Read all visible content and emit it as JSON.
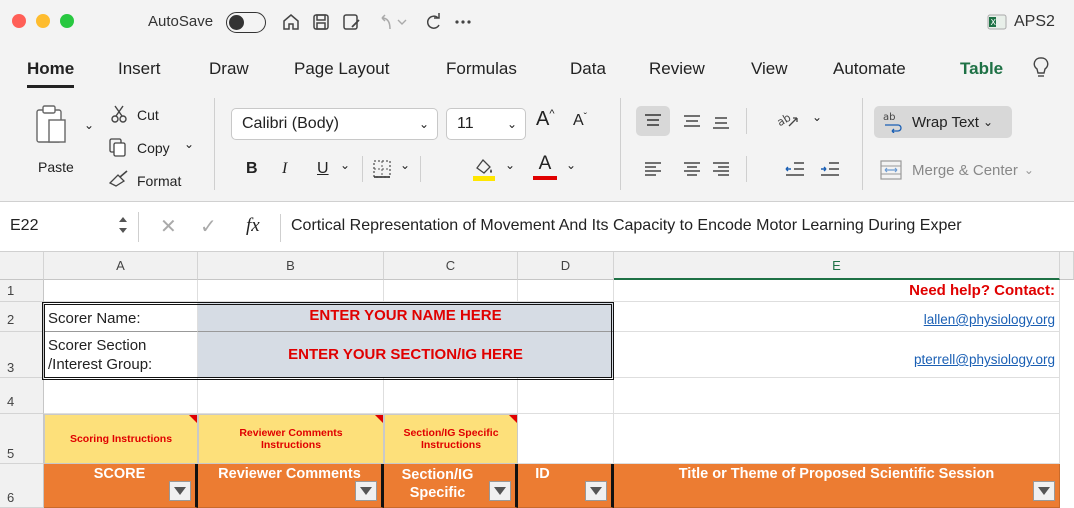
{
  "titlebar": {
    "autosave_label": "AutoSave",
    "workbook_name": "APS2",
    "colors": {
      "close": "#ff5f57",
      "minimize": "#febc2e",
      "zoom": "#28c840"
    },
    "quick_access_icons": [
      "home-icon",
      "save-icon",
      "save-as-icon",
      "undo-icon",
      "undo-dropdown-icon",
      "redo-icon",
      "more-icon"
    ]
  },
  "ribbon_tabs": [
    "Home",
    "Insert",
    "Draw",
    "Page Layout",
    "Formulas",
    "Data",
    "Review",
    "View",
    "Automate",
    "Table"
  ],
  "clipboard": {
    "paste": "Paste",
    "cut": "Cut",
    "copy": "Copy",
    "format": "Format"
  },
  "font": {
    "name": "Calibri (Body)",
    "size": "11",
    "bold": "B",
    "italic": "I",
    "underline": "U",
    "font_color_letter": "A",
    "grow": "A",
    "shrink": "A"
  },
  "alignment": {
    "wrap_text": "Wrap Text",
    "merge_center": "Merge & Center"
  },
  "formula_bar": {
    "name_box": "E22",
    "fx": "fx",
    "content": "Cortical Representation of Movement And Its Capacity to Encode Motor Learning During Exper"
  },
  "sheet": {
    "columns": [
      "A",
      "B",
      "C",
      "D",
      "E"
    ],
    "rows": [
      "1",
      "2",
      "3",
      "4",
      "5",
      "6"
    ],
    "need_help": "Need help?  Contact:",
    "scorer_name_label": "Scorer Name:",
    "scorer_name_value": "ENTER YOUR NAME HERE",
    "scorer_section_label_1": "Scorer Section",
    "scorer_section_label_2": "/Interest Group:",
    "scorer_section_value": "ENTER YOUR SECTION/IG HERE",
    "email_1": "lallen@physiology.org",
    "email_2": "pterrell@physiology.org",
    "instructions": {
      "scoring": "Scoring Instructions",
      "reviewer": "Reviewer Comments Instructions",
      "section": "Section/IG Specific Instructions"
    },
    "headers": {
      "score": "SCORE",
      "reviewer": "Reviewer Comments",
      "section": "Section/IG Specific",
      "id": "ID",
      "title": "Title or Theme of Proposed Scientific Session"
    },
    "colors": {
      "header_orange": "#ec7c32",
      "instruction_yellow": "#fde07a",
      "input_blue": "#d6dce4",
      "alert_red": "#e00000"
    }
  }
}
